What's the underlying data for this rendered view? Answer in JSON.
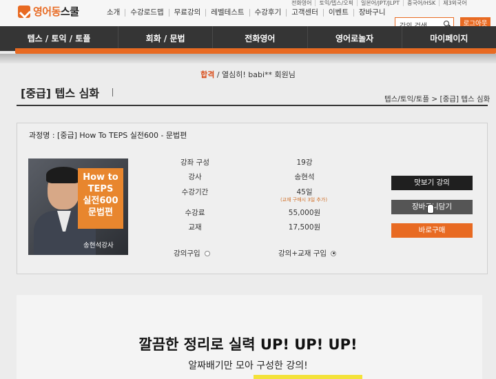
{
  "header": {
    "logo_part1": "영어동",
    "logo_part2": "스쿨",
    "util_nav": [
      "소개",
      "수강로드맵",
      "무료강의",
      "레벨테스트",
      "수강후기",
      "고객센터",
      "이벤트",
      "장바구니"
    ],
    "sub_nav": [
      "전화영어",
      "토익/텝스/오픽",
      "일본어/JPT/JLPT",
      "중국어/HSK",
      "제3외국어"
    ],
    "search_placeholder": "강의 검색",
    "logout_label": "로그아웃"
  },
  "main_nav": [
    "텝스 / 토익 / 토플",
    "회화 / 문법",
    "전화영어",
    "영어로놀자",
    "마이페이지"
  ],
  "welcome": {
    "pass_word": "합격",
    "message": "/ 열심히! babi** 회원님"
  },
  "page": {
    "title": "[중급] 텝스 심화",
    "breadcrumb": "텝스/토익/토플 > [중급] 텝스 심화"
  },
  "course": {
    "name": "과정명 : [중급] How To TEPS 실전600 - 문법편",
    "thumb_badge": [
      "How to",
      "TEPS",
      "실전600",
      "문법편"
    ],
    "thumb_caption": "송현석강사",
    "details": [
      {
        "label": "강좌 구성",
        "value": "19강"
      },
      {
        "label": "강사",
        "value": "송현석"
      },
      {
        "label": "수강기간",
        "value": "45일"
      },
      {
        "label": "수강료",
        "value": "55,000원"
      },
      {
        "label": "교재",
        "value": "17,500원"
      }
    ],
    "period_note": "(교재 구매시 3일 추가)",
    "option_lecture": "강의구입",
    "option_bundle": "강의+교재 구입",
    "btn_preview": "맛보기 강의",
    "btn_cart": "장바구니담기",
    "btn_buy": "바로구매"
  },
  "promo": {
    "headline": "깔끔한 정리로 실력 UP! UP! UP!",
    "subline": "알짜배기만 모아 구성한 강의!"
  },
  "colors": {
    "accent": "#e86a22",
    "nav_bg": "#353535"
  }
}
